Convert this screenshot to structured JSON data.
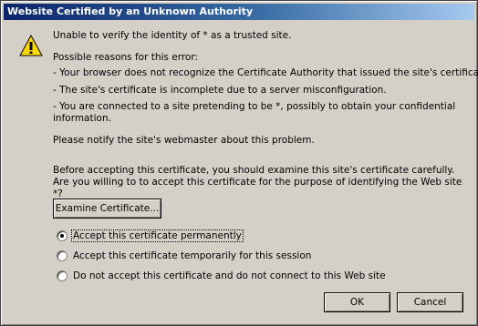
{
  "window": {
    "title": "Website Certified by an Unknown Authority"
  },
  "message": {
    "icon": "warning-icon",
    "line1": "Unable to verify the identity of * as a trusted site.",
    "reasons_heading": "Possible reasons for this error:",
    "reason1": "- Your browser does not recognize the Certificate Authority that issued the site's certificate.",
    "reason2": "- The site's certificate is incomplete due to a server misconfiguration.",
    "reason3": "- You are connected to a site pretending to be *, possibly to obtain your confidential information.",
    "notify": "Please notify the site's webmaster about this problem.",
    "before_accepting": "Before accepting this certificate, you should examine this site's certificate carefully. Are you willing to to accept this certificate for the purpose of identifying the Web site *?"
  },
  "buttons": {
    "examine": "Examine Certificate...",
    "ok": "OK",
    "cancel": "Cancel"
  },
  "options": [
    {
      "label": "Accept this certificate permanently",
      "selected": true
    },
    {
      "label": "Accept this certificate temporarily for this session",
      "selected": false
    },
    {
      "label": "Do not accept this certificate and do not connect to this Web site",
      "selected": false
    }
  ],
  "colors": {
    "dialog_bg": "#d4d0c8",
    "titlebar_start": "#0a246a",
    "titlebar_end": "#a6caf0",
    "warning_yellow": "#ffd800"
  }
}
